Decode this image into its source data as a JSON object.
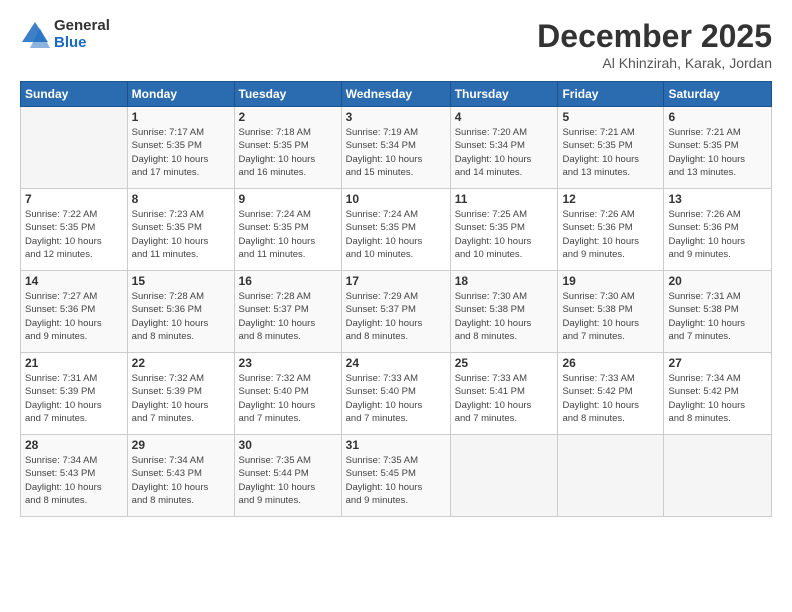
{
  "logo": {
    "general": "General",
    "blue": "Blue"
  },
  "title": "December 2025",
  "location": "Al Khinzirah, Karak, Jordan",
  "headers": [
    "Sunday",
    "Monday",
    "Tuesday",
    "Wednesday",
    "Thursday",
    "Friday",
    "Saturday"
  ],
  "weeks": [
    [
      {
        "day": "",
        "info": ""
      },
      {
        "day": "1",
        "info": "Sunrise: 7:17 AM\nSunset: 5:35 PM\nDaylight: 10 hours\nand 17 minutes."
      },
      {
        "day": "2",
        "info": "Sunrise: 7:18 AM\nSunset: 5:35 PM\nDaylight: 10 hours\nand 16 minutes."
      },
      {
        "day": "3",
        "info": "Sunrise: 7:19 AM\nSunset: 5:34 PM\nDaylight: 10 hours\nand 15 minutes."
      },
      {
        "day": "4",
        "info": "Sunrise: 7:20 AM\nSunset: 5:34 PM\nDaylight: 10 hours\nand 14 minutes."
      },
      {
        "day": "5",
        "info": "Sunrise: 7:21 AM\nSunset: 5:35 PM\nDaylight: 10 hours\nand 13 minutes."
      },
      {
        "day": "6",
        "info": "Sunrise: 7:21 AM\nSunset: 5:35 PM\nDaylight: 10 hours\nand 13 minutes."
      }
    ],
    [
      {
        "day": "7",
        "info": "Sunrise: 7:22 AM\nSunset: 5:35 PM\nDaylight: 10 hours\nand 12 minutes."
      },
      {
        "day": "8",
        "info": "Sunrise: 7:23 AM\nSunset: 5:35 PM\nDaylight: 10 hours\nand 11 minutes."
      },
      {
        "day": "9",
        "info": "Sunrise: 7:24 AM\nSunset: 5:35 PM\nDaylight: 10 hours\nand 11 minutes."
      },
      {
        "day": "10",
        "info": "Sunrise: 7:24 AM\nSunset: 5:35 PM\nDaylight: 10 hours\nand 10 minutes."
      },
      {
        "day": "11",
        "info": "Sunrise: 7:25 AM\nSunset: 5:35 PM\nDaylight: 10 hours\nand 10 minutes."
      },
      {
        "day": "12",
        "info": "Sunrise: 7:26 AM\nSunset: 5:36 PM\nDaylight: 10 hours\nand 9 minutes."
      },
      {
        "day": "13",
        "info": "Sunrise: 7:26 AM\nSunset: 5:36 PM\nDaylight: 10 hours\nand 9 minutes."
      }
    ],
    [
      {
        "day": "14",
        "info": "Sunrise: 7:27 AM\nSunset: 5:36 PM\nDaylight: 10 hours\nand 9 minutes."
      },
      {
        "day": "15",
        "info": "Sunrise: 7:28 AM\nSunset: 5:36 PM\nDaylight: 10 hours\nand 8 minutes."
      },
      {
        "day": "16",
        "info": "Sunrise: 7:28 AM\nSunset: 5:37 PM\nDaylight: 10 hours\nand 8 minutes."
      },
      {
        "day": "17",
        "info": "Sunrise: 7:29 AM\nSunset: 5:37 PM\nDaylight: 10 hours\nand 8 minutes."
      },
      {
        "day": "18",
        "info": "Sunrise: 7:30 AM\nSunset: 5:38 PM\nDaylight: 10 hours\nand 8 minutes."
      },
      {
        "day": "19",
        "info": "Sunrise: 7:30 AM\nSunset: 5:38 PM\nDaylight: 10 hours\nand 7 minutes."
      },
      {
        "day": "20",
        "info": "Sunrise: 7:31 AM\nSunset: 5:38 PM\nDaylight: 10 hours\nand 7 minutes."
      }
    ],
    [
      {
        "day": "21",
        "info": "Sunrise: 7:31 AM\nSunset: 5:39 PM\nDaylight: 10 hours\nand 7 minutes."
      },
      {
        "day": "22",
        "info": "Sunrise: 7:32 AM\nSunset: 5:39 PM\nDaylight: 10 hours\nand 7 minutes."
      },
      {
        "day": "23",
        "info": "Sunrise: 7:32 AM\nSunset: 5:40 PM\nDaylight: 10 hours\nand 7 minutes."
      },
      {
        "day": "24",
        "info": "Sunrise: 7:33 AM\nSunset: 5:40 PM\nDaylight: 10 hours\nand 7 minutes."
      },
      {
        "day": "25",
        "info": "Sunrise: 7:33 AM\nSunset: 5:41 PM\nDaylight: 10 hours\nand 7 minutes."
      },
      {
        "day": "26",
        "info": "Sunrise: 7:33 AM\nSunset: 5:42 PM\nDaylight: 10 hours\nand 8 minutes."
      },
      {
        "day": "27",
        "info": "Sunrise: 7:34 AM\nSunset: 5:42 PM\nDaylight: 10 hours\nand 8 minutes."
      }
    ],
    [
      {
        "day": "28",
        "info": "Sunrise: 7:34 AM\nSunset: 5:43 PM\nDaylight: 10 hours\nand 8 minutes."
      },
      {
        "day": "29",
        "info": "Sunrise: 7:34 AM\nSunset: 5:43 PM\nDaylight: 10 hours\nand 8 minutes."
      },
      {
        "day": "30",
        "info": "Sunrise: 7:35 AM\nSunset: 5:44 PM\nDaylight: 10 hours\nand 9 minutes."
      },
      {
        "day": "31",
        "info": "Sunrise: 7:35 AM\nSunset: 5:45 PM\nDaylight: 10 hours\nand 9 minutes."
      },
      {
        "day": "",
        "info": ""
      },
      {
        "day": "",
        "info": ""
      },
      {
        "day": "",
        "info": ""
      }
    ]
  ]
}
